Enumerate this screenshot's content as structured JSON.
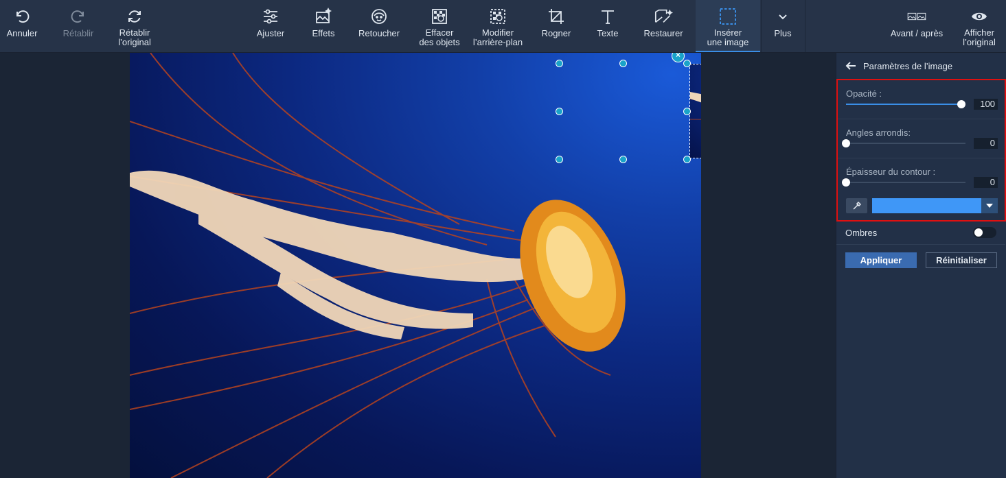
{
  "toolbar": {
    "undo": "Annuler",
    "redo": "Rétablir",
    "restore_original": "Rétablir\nl’original",
    "adjust": "Ajuster",
    "effects": "Effets",
    "retouch": "Retoucher",
    "erase_objects": "Effacer\ndes objets",
    "change_background": "Modifier\nl’arrière-plan",
    "crop": "Rogner",
    "text": "Texte",
    "restore": "Restaurer",
    "insert_image": "Insérer\nune image",
    "more": "Plus",
    "before_after": "Avant / après",
    "show_original": "Afficher\nl’original"
  },
  "panel": {
    "title": "Paramètres de l’image",
    "opacity_label": "Opacité :",
    "opacity_value": "100",
    "opacity_fraction": 1.0,
    "corners_label": "Angles arrondis:",
    "corners_value": "0",
    "corners_fraction": 0,
    "outline_label": "Épaisseur du contour :",
    "outline_value": "0",
    "outline_fraction": 0,
    "outline_color": "#3f97f7",
    "shadows_label": "Ombres",
    "shadows_on": false,
    "apply_label": "Appliquer",
    "reset_label": "Réinitialiser"
  },
  "colors": {
    "toolbar_bg": "#263348",
    "panel_bg": "#223047",
    "accent": "#3a8ee6",
    "highlight_border": "#e01010",
    "handle": "#1aa3c9"
  }
}
